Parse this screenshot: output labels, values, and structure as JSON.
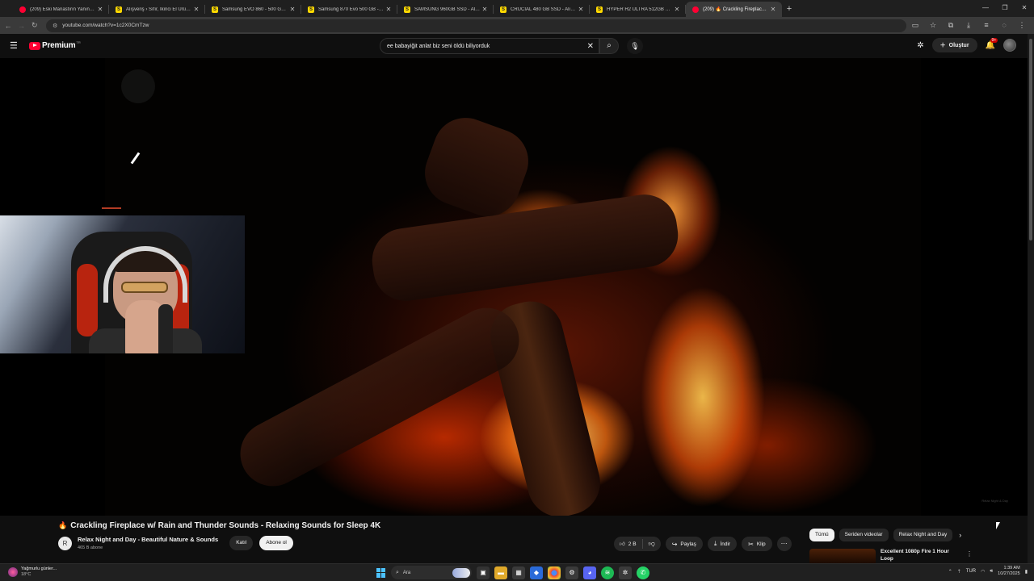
{
  "tabs": [
    {
      "favicon": "youtube-icon",
      "color": "#ff0033",
      "title": "(209) Eski Manastırın Yanında D"
    },
    {
      "favicon": "S",
      "color": "#ffd900",
      "title": "Alışveriş › Sıfır, İkinci El Ürünler"
    },
    {
      "favicon": "S",
      "color": "#ffd900",
      "title": "Samsung EVO 860 - 500 GB - A"
    },
    {
      "favicon": "S",
      "color": "#ffd900",
      "title": "Samsung 870 Evo 500 GB - Alış"
    },
    {
      "favicon": "S",
      "color": "#ffd900",
      "title": "SAMSUNG 960GB SSD - Alışver"
    },
    {
      "favicon": "S",
      "color": "#ffd900",
      "title": "CRUCIAL 480 GB SSD - Alışveri"
    },
    {
      "favicon": "S",
      "color": "#ffd900",
      "title": "HYPER H2 ULTRA 512GB SSD D"
    },
    {
      "favicon": "youtube-icon",
      "color": "#ff0033",
      "title": "(209) 🔥 Crackling Fireplace w/",
      "active": true
    }
  ],
  "address": {
    "url": "youtube.com/watch?v=1c2X0CmTzw"
  },
  "youtube": {
    "brand": "Premium",
    "brand_cc": "TR",
    "search_query": "ee babayiğit anlat biz seni öldü biliyorduk",
    "create_label": "Oluştur",
    "notif_count": "9+"
  },
  "video": {
    "title_emoji": "🔥",
    "title": "Crackling Fireplace w/ Rain and Thunder Sounds - Relaxing Sounds for Sleep 4K",
    "watermark": "Relax Night & Day"
  },
  "channel": {
    "avatar_letter": "R",
    "name": "Relax Night and Day - Beautiful Nature & Sounds",
    "subs": "465 B abone",
    "join_label": "Katıl",
    "subscribe_label": "Abone ol"
  },
  "actions": {
    "likes": "2 B",
    "share": "Paylaş",
    "download": "İndir",
    "clip": "Klip"
  },
  "chips": [
    "Tümü",
    "Seriden videolar",
    "Relax Night and Day"
  ],
  "recommendation": {
    "title": "Excellent 1080p Fire 1 Hour Loop"
  },
  "taskbar": {
    "weather_title": "Yağmurlu günler...",
    "weather_temp": "18°C",
    "search_placeholder": "Ara",
    "lang": "TUR",
    "time": "1:39 AM",
    "date": "10/27/2025"
  }
}
